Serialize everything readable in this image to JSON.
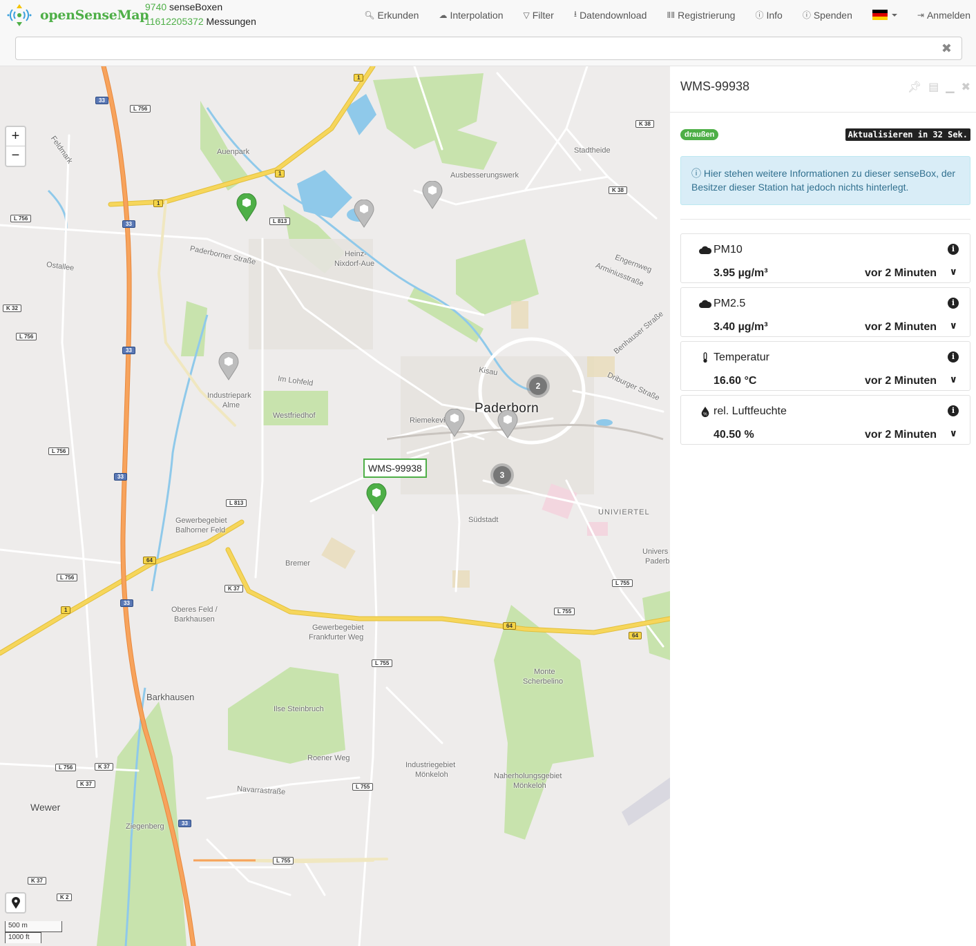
{
  "header": {
    "brand": "openSenseMap",
    "box_count": "9740",
    "box_label": "senseBoxen",
    "measurement_count": "11612205372",
    "measurement_label": "Messungen",
    "nav": {
      "explore": "Erkunden",
      "interpolation": "Interpolation",
      "filter": "Filter",
      "download": "Datendownload",
      "register": "Registrierung",
      "info": "Info",
      "donate": "Spenden",
      "login": "Anmelden"
    },
    "language": "de"
  },
  "search": {
    "value": "",
    "placeholder": ""
  },
  "map": {
    "city": "Paderborn",
    "labels": {
      "auenpark": "Auenpark",
      "heinz": "Heinz-",
      "nixdorf_aue": "Nixdorf-Aue",
      "ausbesserungswerk": "Ausbesserungswerk",
      "stadtheide": "Stadtheide",
      "industriepark": "Industriepark",
      "alme": "Alme",
      "westfriedhof": "Westfriedhof",
      "im_lohfeld": "Im Lohfeld",
      "paderborner_strasse": "Paderborner Straße",
      "ostallee": "Ostallee",
      "feldmark": "Feldmark",
      "kisau": "Kisau",
      "riemekeviertel": "Riemekeviertel",
      "suedstadt": "Südstadt",
      "univiertel": "UNIVIERTEL",
      "gewerbegebiet_balhorner": "Gewerbegebiet",
      "balhorner_feld": "Balhorner Feld",
      "bremer": "Bremer",
      "oberes_feld": "Oberes Feld /",
      "barkhausen_1": "Barkhausen",
      "gewerbegebiet_frankfurter": "Gewerbegebiet",
      "frankfurter_weg": "Frankfurter Weg",
      "monte": "Monte",
      "scherbelino": "Scherbelino",
      "barkhausen_2": "Barkhausen",
      "ilse_steinbruch": "Ilse Steinbruch",
      "roener_weg": "Roener Weg",
      "industriegebiet": "Industriegebiet",
      "moenkeloh_1": "Mönkeloh",
      "naherholungsgebiet": "Naherholungsgebiet",
      "moenkeloh_2": "Mönkeloh",
      "navarrastrasse": "Navarrastraße",
      "wewer": "Wewer",
      "ziegenberg": "Ziegenberg",
      "engernweg": "Engernweg",
      "arminiusstrasse": "Arminiusstraße",
      "driburger_strasse": "Driburger Straße",
      "benhauser_strasse": "Benhauser Straße",
      "universitaet": "Univers",
      "universitaet_2": "Paderb"
    },
    "clusters": [
      "2",
      "3"
    ],
    "selected_popup": "WMS-99938",
    "zoom_in": "+",
    "zoom_out": "−",
    "scale_metric": "500 m",
    "scale_imperial": "1000 ft",
    "shields": {
      "a33_1": "33",
      "a33_2": "33",
      "a33_3": "33",
      "a33_4": "33",
      "a33_5": "33",
      "a33_6": "33",
      "b1_1": "1",
      "b1_2": "1",
      "b1_3": "1",
      "b1_4": "1",
      "b64_1": "64",
      "b64_2": "64",
      "b64_3": "64",
      "l756_1": "L 756",
      "l756_2": "L 756",
      "l756_3": "L 756",
      "l756_4": "L 756",
      "l756_5": "L 756",
      "l756_6": "L 756",
      "l813_1": "L 813",
      "l813_2": "L 813",
      "k37_1": "K 37",
      "k37_2": "K 37",
      "k37_3": "K 37",
      "k37_4": "K 37",
      "k38_1": "K 38",
      "k38_2": "K 38",
      "l755_1": "L 755",
      "l755_2": "L 755",
      "l755_3": "L 755",
      "l755_4": "L 755",
      "l755_5": "L 755",
      "k32": "K 32",
      "k2": "K 2"
    }
  },
  "sidebar": {
    "title": "WMS-99938",
    "exposure": "draußen",
    "refresh": "Aktualisieren in 32 Sek.",
    "info_text": "Hier stehen weitere Informationen zu dieser senseBox, der Besitzer dieser Station hat jedoch nichts hinterlegt.",
    "sensors": [
      {
        "title": "PM10",
        "value": "3.95 µg/m³",
        "time": "vor 2 Minuten",
        "icon": "cloud-icon"
      },
      {
        "title": "PM2.5",
        "value": "3.40 µg/m³",
        "time": "vor 2 Minuten",
        "icon": "cloud-icon"
      },
      {
        "title": "Temperatur",
        "value": "16.60 °C",
        "time": "vor 2 Minuten",
        "icon": "thermometer-icon"
      },
      {
        "title": "rel. Luftfeuchte",
        "value": "40.50 %",
        "time": "vor 2 Minuten",
        "icon": "humidity-icon"
      }
    ]
  },
  "colors": {
    "brand": "#4eaf47",
    "info_bg": "#d9edf7",
    "info_text": "#31708f",
    "motorway": "#f39a4d",
    "primary_road": "#f6d65b",
    "water": "#89c8ea",
    "park": "#c7e4a8"
  }
}
